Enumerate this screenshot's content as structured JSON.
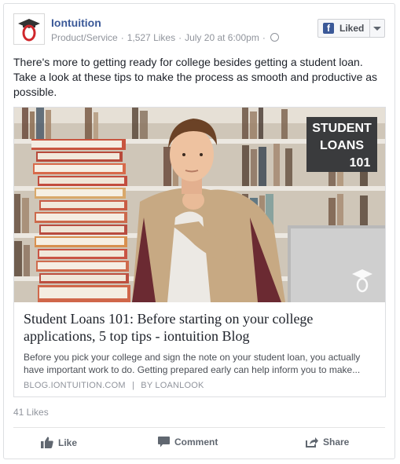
{
  "post": {
    "page_name": "Iontuition",
    "category": "Product/Service",
    "page_likes": "1,527 Likes",
    "date": "July 20 at 6:00pm",
    "liked_label": "Liked",
    "text": "There's more to getting ready for college besides getting a student loan. Take a look at these tips to make the process as smooth and productive as possible."
  },
  "attachment": {
    "image_overlay": [
      "STUDENT",
      "LOANS",
      "101"
    ],
    "title": "Student Loans 101: Before starting on your college applications, 5 top tips - iontuition Blog",
    "description": "Before you pick your college and sign the note on your student loan, you actually have important work to do. Getting prepared early can help inform you to make...",
    "source": "BLOG.IONTUITION.COM",
    "author": "BY LOANLOOK"
  },
  "footer": {
    "likes": "41 Likes",
    "actions": {
      "like": "Like",
      "comment": "Comment",
      "share": "Share"
    }
  },
  "colors": {
    "brand": "#3b5998",
    "logo_red": "#d0262b",
    "overlay_bg": "#3a3b3d",
    "muted": "#90949c"
  },
  "icons": [
    "graduation-cap-logo-icon",
    "globe-icon",
    "facebook-icon",
    "chevron-down-icon",
    "thumbs-up-icon",
    "comment-icon",
    "share-icon",
    "graduation-cap-watermark-icon"
  ]
}
